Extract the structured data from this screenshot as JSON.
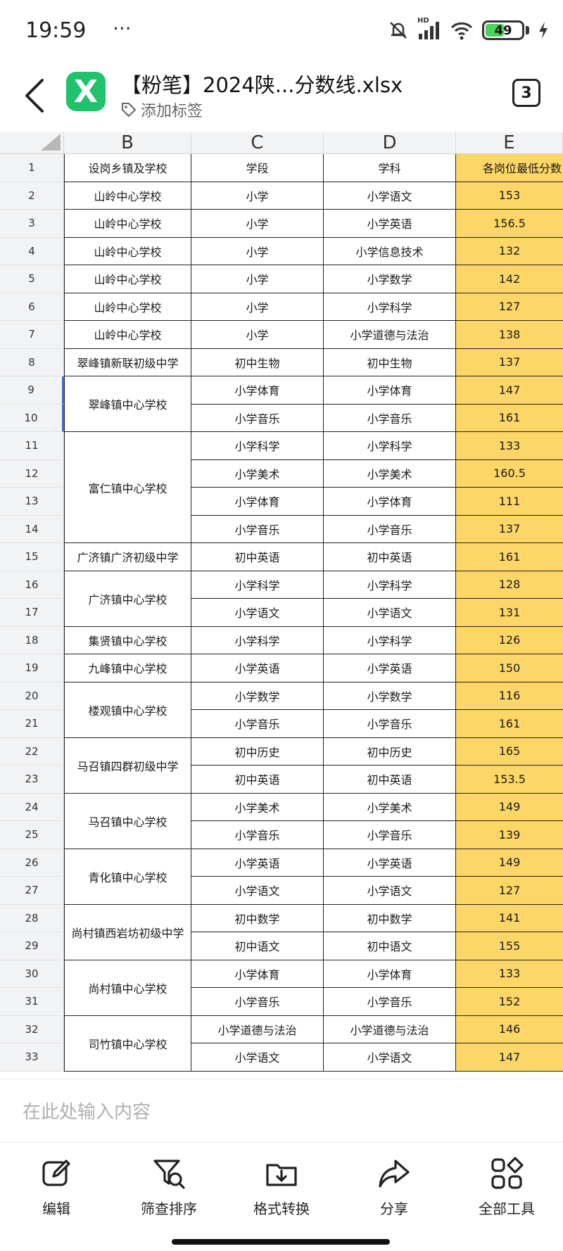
{
  "status": {
    "time": "19:59",
    "dots": "···",
    "battery": "49",
    "net": "HD"
  },
  "header": {
    "app_letter": "X",
    "file_title": "【粉笔】2024陕...分数线.xlsx",
    "tag_label": "添加标签",
    "page_count": "3"
  },
  "sheet": {
    "columns": [
      "B",
      "C",
      "D",
      "E"
    ],
    "header_row": [
      "设岗乡镇及学校",
      "学段",
      "学科",
      "各岗位最低分数"
    ],
    "row_numbers": [
      "1",
      "2",
      "3",
      "4",
      "5",
      "6",
      "7",
      "8",
      "9",
      "10",
      "11",
      "12",
      "13",
      "14",
      "15",
      "16",
      "17",
      "18",
      "19",
      "20",
      "21",
      "22",
      "23",
      "24",
      "25",
      "26",
      "27",
      "28",
      "29",
      "30",
      "31",
      "32",
      "33"
    ],
    "schools": [
      {
        "name": "山岭中心学校",
        "span": 1
      },
      {
        "name": "山岭中心学校",
        "span": 1
      },
      {
        "name": "山岭中心学校",
        "span": 1
      },
      {
        "name": "山岭中心学校",
        "span": 1
      },
      {
        "name": "山岭中心学校",
        "span": 1
      },
      {
        "name": "山岭中心学校",
        "span": 1
      },
      {
        "name": "翠峰镇新联初级中学",
        "span": 1
      },
      {
        "name": "翠峰镇中心学校",
        "span": 2
      },
      {
        "name": "富仁镇中心学校",
        "span": 4
      },
      {
        "name": "广济镇广济初级中学",
        "span": 1
      },
      {
        "name": "广济镇中心学校",
        "span": 2
      },
      {
        "name": "集贤镇中心学校",
        "span": 1
      },
      {
        "name": "九峰镇中心学校",
        "span": 1
      },
      {
        "name": "楼观镇中心学校",
        "span": 2
      },
      {
        "name": "马召镇四群初级中学",
        "span": 2
      },
      {
        "name": "马召镇中心学校",
        "span": 2
      },
      {
        "name": "青化镇中心学校",
        "span": 2
      },
      {
        "name": "尚村镇西岩坊初级中学",
        "span": 2
      },
      {
        "name": "尚村镇中心学校",
        "span": 2
      },
      {
        "name": "司竹镇中心学校",
        "span": 2
      }
    ],
    "rows": [
      {
        "stage": "小学",
        "subject": "小学语文",
        "score": "153"
      },
      {
        "stage": "小学",
        "subject": "小学英语",
        "score": "156.5"
      },
      {
        "stage": "小学",
        "subject": "小学信息技术",
        "score": "132"
      },
      {
        "stage": "小学",
        "subject": "小学数学",
        "score": "142"
      },
      {
        "stage": "小学",
        "subject": "小学科学",
        "score": "127"
      },
      {
        "stage": "小学",
        "subject": "小学道德与法治",
        "score": "138"
      },
      {
        "stage": "初中生物",
        "subject": "初中生物",
        "score": "137"
      },
      {
        "stage": "小学体育",
        "subject": "小学体育",
        "score": "147"
      },
      {
        "stage": "小学音乐",
        "subject": "小学音乐",
        "score": "161"
      },
      {
        "stage": "小学科学",
        "subject": "小学科学",
        "score": "133"
      },
      {
        "stage": "小学美术",
        "subject": "小学美术",
        "score": "160.5"
      },
      {
        "stage": "小学体育",
        "subject": "小学体育",
        "score": "111"
      },
      {
        "stage": "小学音乐",
        "subject": "小学音乐",
        "score": "137"
      },
      {
        "stage": "初中英语",
        "subject": "初中英语",
        "score": "161"
      },
      {
        "stage": "小学科学",
        "subject": "小学科学",
        "score": "128"
      },
      {
        "stage": "小学语文",
        "subject": "小学语文",
        "score": "131"
      },
      {
        "stage": "小学科学",
        "subject": "小学科学",
        "score": "126"
      },
      {
        "stage": "小学英语",
        "subject": "小学英语",
        "score": "150"
      },
      {
        "stage": "小学数学",
        "subject": "小学数学",
        "score": "116"
      },
      {
        "stage": "小学音乐",
        "subject": "小学音乐",
        "score": "161"
      },
      {
        "stage": "初中历史",
        "subject": "初中历史",
        "score": "165"
      },
      {
        "stage": "初中英语",
        "subject": "初中英语",
        "score": "153.5"
      },
      {
        "stage": "小学美术",
        "subject": "小学美术",
        "score": "149"
      },
      {
        "stage": "小学音乐",
        "subject": "小学音乐",
        "score": "139"
      },
      {
        "stage": "小学英语",
        "subject": "小学英语",
        "score": "149"
      },
      {
        "stage": "小学语文",
        "subject": "小学语文",
        "score": "127"
      },
      {
        "stage": "初中数学",
        "subject": "初中数学",
        "score": "141"
      },
      {
        "stage": "初中语文",
        "subject": "初中语文",
        "score": "155"
      },
      {
        "stage": "小学体育",
        "subject": "小学体育",
        "score": "133"
      },
      {
        "stage": "小学音乐",
        "subject": "小学音乐",
        "score": "152"
      },
      {
        "stage": "小学道德与法治",
        "subject": "小学道德与法治",
        "score": "146"
      },
      {
        "stage": "小学语文",
        "subject": "小学语文",
        "score": "147"
      }
    ],
    "highlight_color": "#fcd667"
  },
  "input": {
    "placeholder": "在此处输入内容"
  },
  "toolbar": {
    "items": [
      {
        "label": "编辑",
        "icon": "edit-icon"
      },
      {
        "label": "筛查排序",
        "icon": "filter-search-icon"
      },
      {
        "label": "格式转换",
        "icon": "format-convert-icon"
      },
      {
        "label": "分享",
        "icon": "share-icon"
      },
      {
        "label": "全部工具",
        "icon": "all-tools-icon"
      }
    ]
  }
}
